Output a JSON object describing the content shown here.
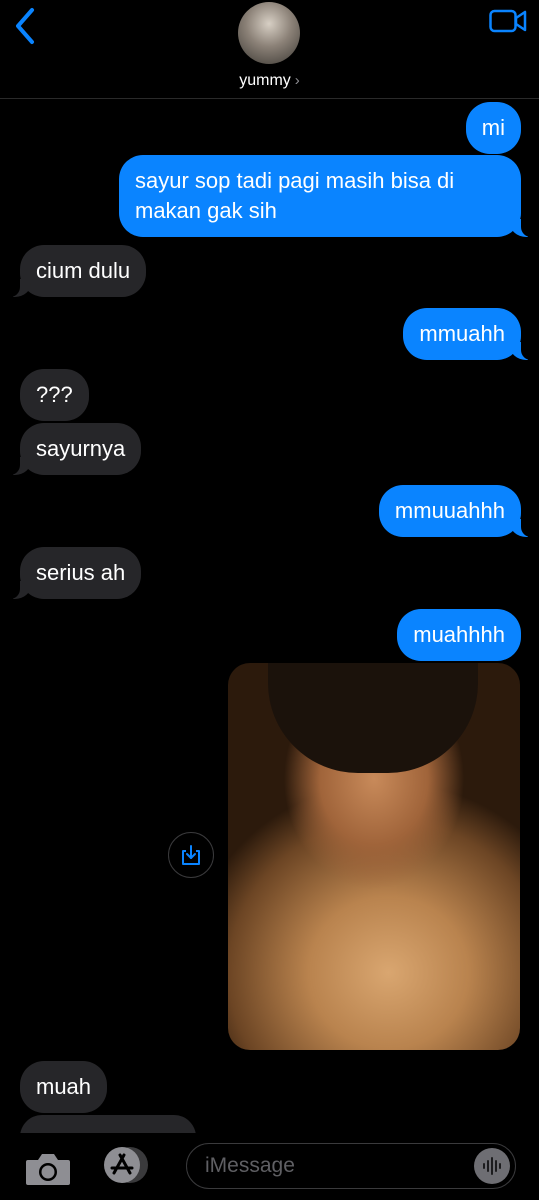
{
  "header": {
    "contact_name": "yummy",
    "chevron": "›"
  },
  "messages": [
    {
      "dir": "out",
      "text": "mi"
    },
    {
      "dir": "out",
      "text": "sayur sop tadi pagi masih bisa di makan gak sih"
    },
    {
      "dir": "in",
      "text": "cium dulu"
    },
    {
      "dir": "out",
      "text": "mmuahh"
    },
    {
      "dir": "in",
      "text": "???"
    },
    {
      "dir": "in",
      "text": "sayurnya"
    },
    {
      "dir": "out",
      "text": "mmuuahhh"
    },
    {
      "dir": "in",
      "text": "serius ah"
    },
    {
      "dir": "out",
      "text": "muahhhh"
    },
    {
      "dir": "out",
      "type": "photo"
    },
    {
      "dir": "in",
      "text": "muah"
    }
  ],
  "composer": {
    "placeholder": "iMessage"
  },
  "icons": {
    "back": "chevron-left-icon",
    "video": "video-camera-icon",
    "save": "download-icon",
    "camera": "camera-icon",
    "apps": "app-store-icon",
    "audio": "waveform-icon"
  },
  "colors": {
    "outgoing": "#0a84ff",
    "incoming": "#262629",
    "background": "#000000"
  }
}
